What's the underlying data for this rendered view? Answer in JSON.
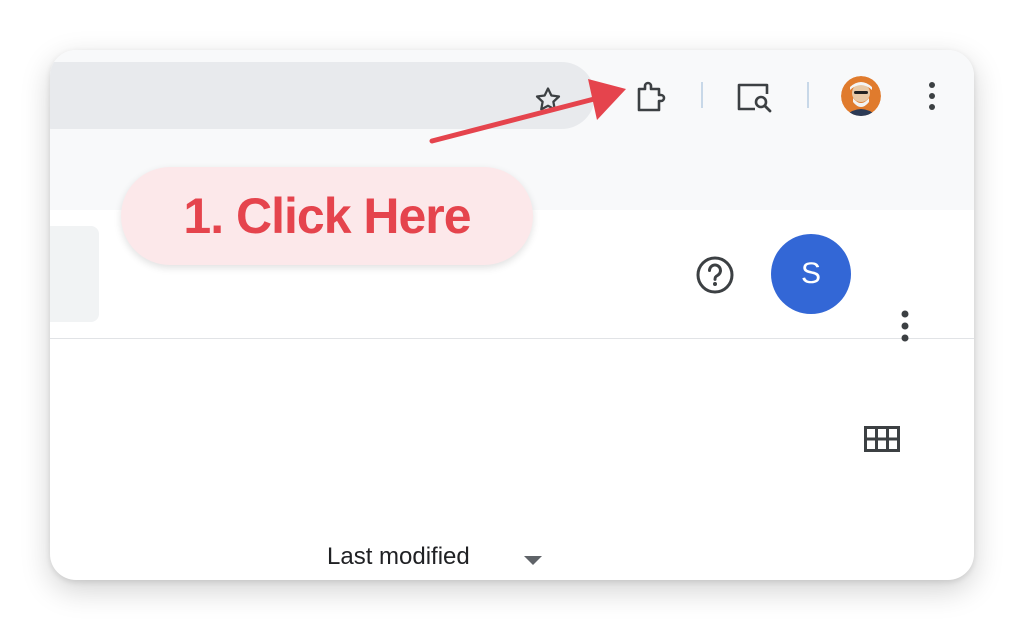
{
  "browser": {
    "toolbar_icons": [
      "star-icon",
      "extensions-puzzle-icon",
      "google-lens-search-icon",
      "profile-avatar",
      "more-vert-icon"
    ]
  },
  "app": {
    "user_initial": "S",
    "sort": {
      "label": "Last modified",
      "icon": "caret-down-icon"
    },
    "icons": [
      "help-circle-icon",
      "more-vert-icon",
      "grid-view-icon"
    ]
  },
  "annotation": {
    "text": "1. Click Here",
    "color": "#e5444d",
    "background": "#fce8ea"
  },
  "colors": {
    "avatar": "#3367d6",
    "toolbar": "#f8f9fa",
    "omnibox": "#e8eaed"
  }
}
